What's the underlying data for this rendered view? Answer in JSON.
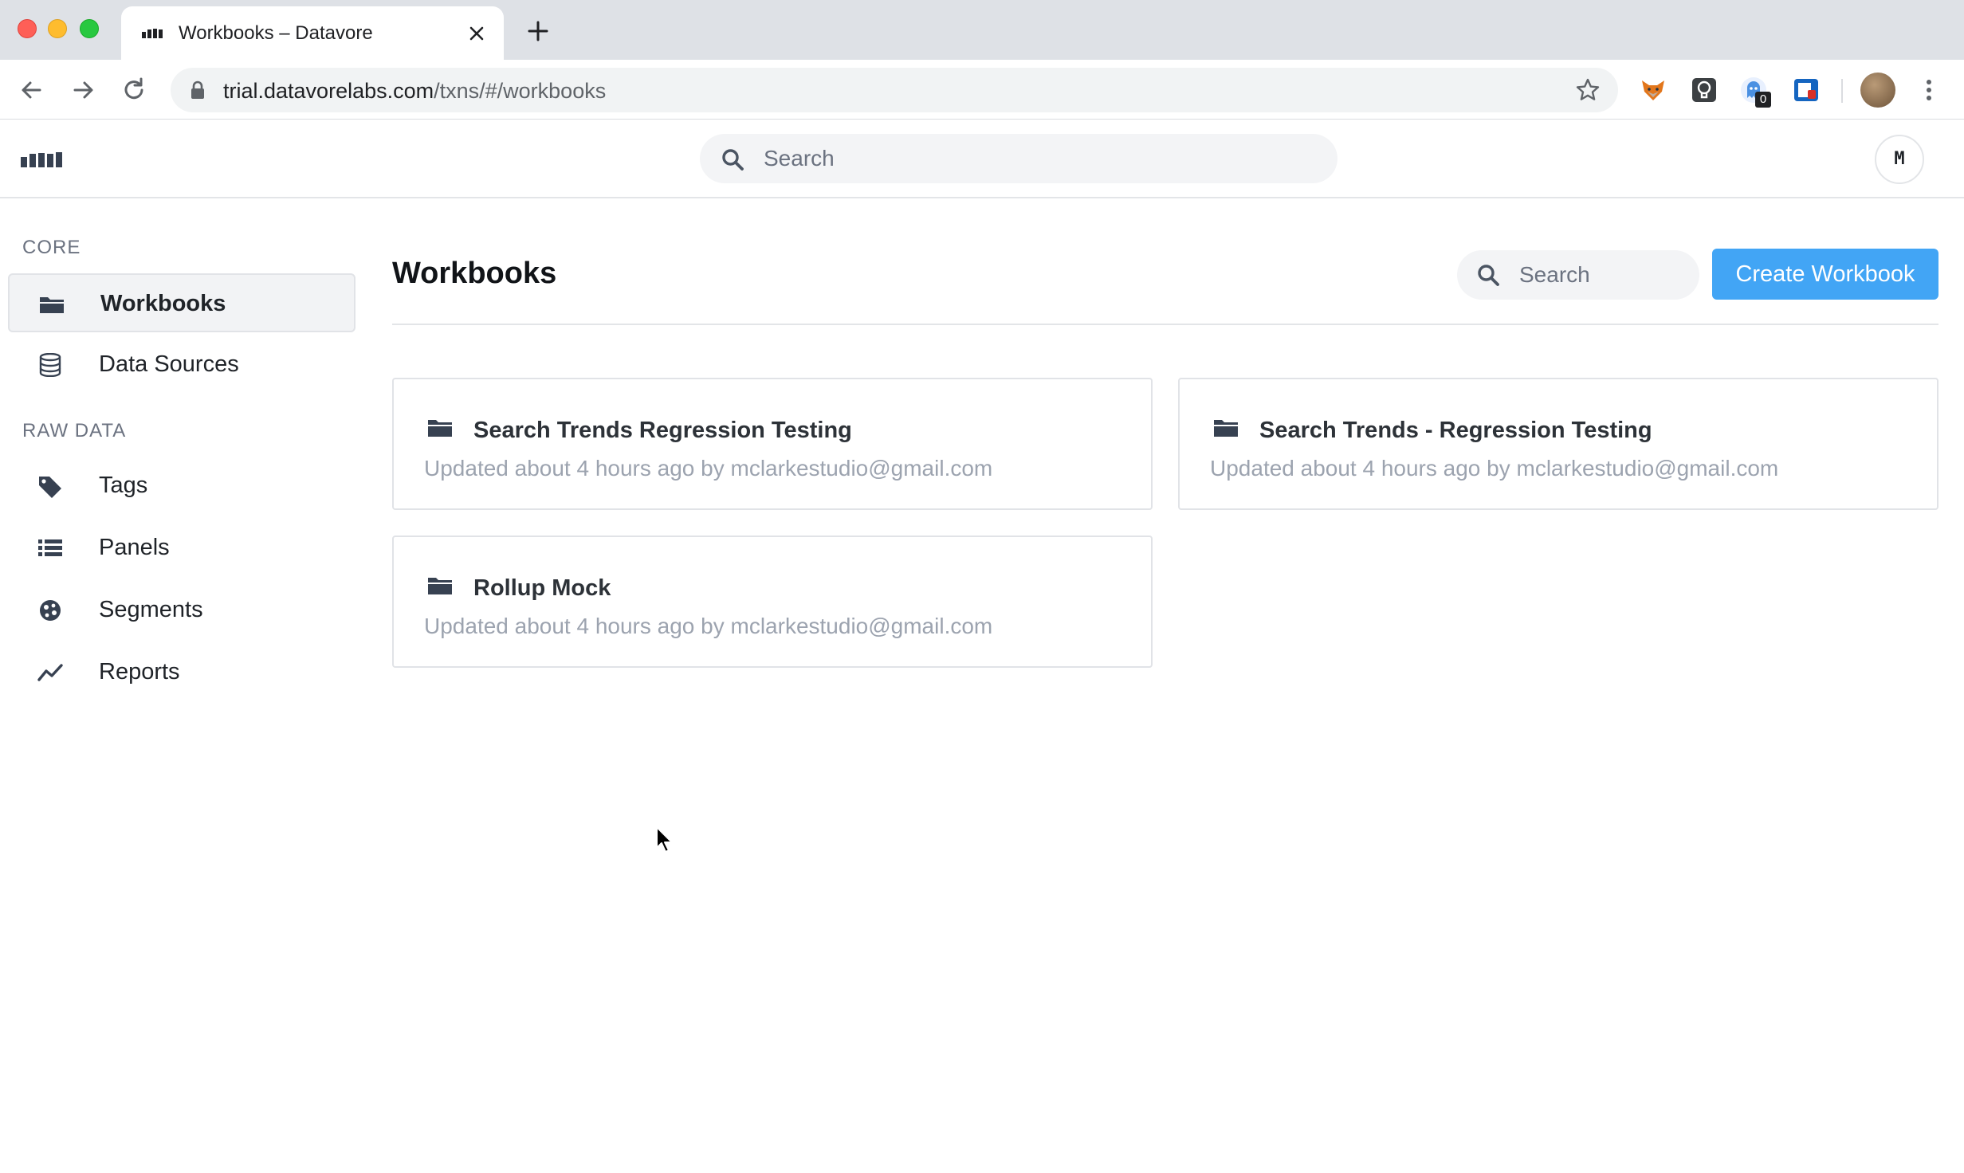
{
  "browser": {
    "tab_title": "Workbooks – Datavore",
    "url_host": "trial.datavorelabs.com",
    "url_path": "/txns/#/workbooks",
    "extension_badge": "0"
  },
  "header": {
    "search_placeholder": "Search",
    "user_initial": "M"
  },
  "sidebar": {
    "sections": [
      {
        "label": "CORE",
        "items": [
          {
            "label": "Workbooks",
            "icon": "folder-icon",
            "active": true
          },
          {
            "label": "Data Sources",
            "icon": "database-icon",
            "active": false
          }
        ]
      },
      {
        "label": "RAW DATA",
        "items": [
          {
            "label": "Tags",
            "icon": "tag-icon",
            "active": false
          },
          {
            "label": "Panels",
            "icon": "list-icon",
            "active": false
          },
          {
            "label": "Segments",
            "icon": "segments-icon",
            "active": false
          },
          {
            "label": "Reports",
            "icon": "line-chart-icon",
            "active": false
          }
        ]
      }
    ]
  },
  "main": {
    "title": "Workbooks",
    "search_placeholder": "Search",
    "create_button": "Create Workbook",
    "workbooks": [
      {
        "title": "Search Trends Regression Testing",
        "meta": "Updated about 4 hours ago by mclarkestudio@gmail.com"
      },
      {
        "title": "Search Trends - Regression Testing",
        "meta": "Updated about 4 hours ago by mclarkestudio@gmail.com"
      },
      {
        "title": "Rollup Mock",
        "meta": "Updated about 4 hours ago by mclarkestudio@gmail.com"
      }
    ]
  },
  "colors": {
    "accent": "#42a5f5",
    "active_nav_bg": "#f2f3f5"
  }
}
